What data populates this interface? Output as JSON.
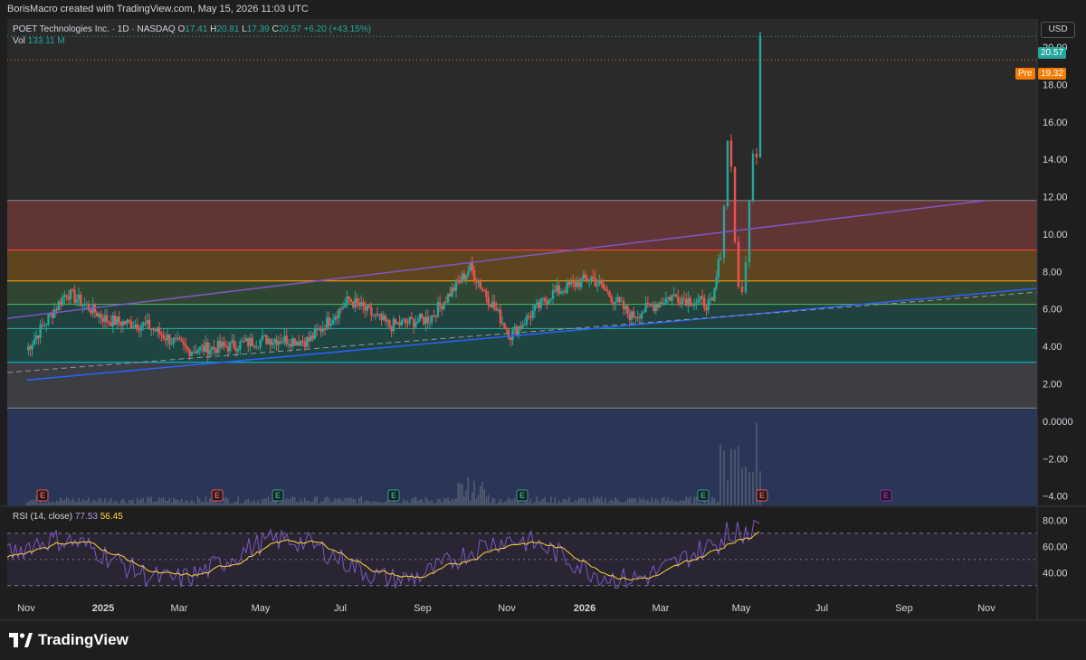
{
  "header": {
    "attribution": "BorisMacro created with TradingView.com, May 15, 2026 11:03 UTC"
  },
  "legend": {
    "symbol": "POET Technologies Inc. · 1D · NASDAQ",
    "open_label": "O",
    "open": "17.41",
    "high_label": "H",
    "high": "20.81",
    "low_label": "L",
    "low": "17.39",
    "close_label": "C",
    "close": "20.57",
    "change": "+6.20 (+43.15%)",
    "vol_label": "Vol",
    "vol": "133.11 M"
  },
  "rsi_legend": {
    "label": "RSI (14, close)",
    "rsi": "77.53",
    "ma": "56.45"
  },
  "price_axis": {
    "currency": "USD",
    "last_price": "20.57",
    "pre_label": "Pre",
    "pre_price": "19.32",
    "ticks": [
      "20.00",
      "18.00",
      "16.00",
      "14.00",
      "12.00",
      "10.00",
      "8.00",
      "6.00",
      "4.00",
      "2.00",
      "0.0000",
      "−2.00",
      "−4.00"
    ],
    "rsi_ticks": [
      "80.00",
      "60.00",
      "40.00"
    ]
  },
  "time_axis": [
    "Nov",
    "2025",
    "Mar",
    "May",
    "Jul",
    "Sep",
    "Nov",
    "2026",
    "Mar",
    "May",
    "Jul",
    "Sep",
    "Nov"
  ],
  "earnings_markers": [
    "E",
    "E",
    "E",
    "E",
    "E",
    "E",
    "E",
    "E"
  ],
  "brand": {
    "name": "TradingView"
  },
  "colors": {
    "up": "#26a69a",
    "down": "#ef5350",
    "accent_orange": "#f57c00",
    "fib_red": "#f44336",
    "fib_orange": "#ff9800",
    "fib_green": "#4caf50",
    "fib_teal": "#26a69a",
    "fib_cyan": "#00bcd4",
    "fib_gray": "#787b86",
    "trendline_blue": "#2962ff",
    "trendline_purple": "#7e57c2",
    "rsi_line": "#7e57c2",
    "rsi_ma": "#fdd835"
  },
  "chart_data": {
    "type": "candlestick",
    "title": "POET Technologies Inc. · 1D · NASDAQ",
    "ylim": [
      -4.5,
      21.5
    ],
    "fib_levels": [
      11.8,
      9.15,
      7.5,
      6.25,
      4.95,
      3.15,
      0.7
    ],
    "trendlines": [
      {
        "from": [
          "2024-11",
          2.2
        ],
        "to": [
          "2026-10",
          7.1
        ]
      },
      {
        "from": [
          "2024-10",
          5.5
        ],
        "to": [
          "2026-08",
          11.8
        ]
      }
    ],
    "monthly_close": [
      {
        "x": "2024-11",
        "y": 3.8
      },
      {
        "x": "2024-12",
        "y": 6.9
      },
      {
        "x": "2025-01",
        "y": 5.4
      },
      {
        "x": "2025-02",
        "y": 5.1
      },
      {
        "x": "2025-03",
        "y": 3.8
      },
      {
        "x": "2025-04",
        "y": 4.0
      },
      {
        "x": "2025-05",
        "y": 4.4
      },
      {
        "x": "2025-06",
        "y": 4.3
      },
      {
        "x": "2025-07",
        "y": 6.5
      },
      {
        "x": "2025-08",
        "y": 5.1
      },
      {
        "x": "2025-09",
        "y": 5.5
      },
      {
        "x": "2025-10",
        "y": 8.2
      },
      {
        "x": "2025-11",
        "y": 4.6
      },
      {
        "x": "2025-12",
        "y": 6.8
      },
      {
        "x": "2026-01",
        "y": 7.7
      },
      {
        "x": "2026-02",
        "y": 5.6
      },
      {
        "x": "2026-03",
        "y": 6.7
      },
      {
        "x": "2026-04",
        "y": 6.2
      },
      {
        "x": "2026-05",
        "y": 20.57
      }
    ],
    "rsi_ylim": [
      25,
      90
    ],
    "rsi_levels": [
      70,
      50,
      30
    ]
  }
}
